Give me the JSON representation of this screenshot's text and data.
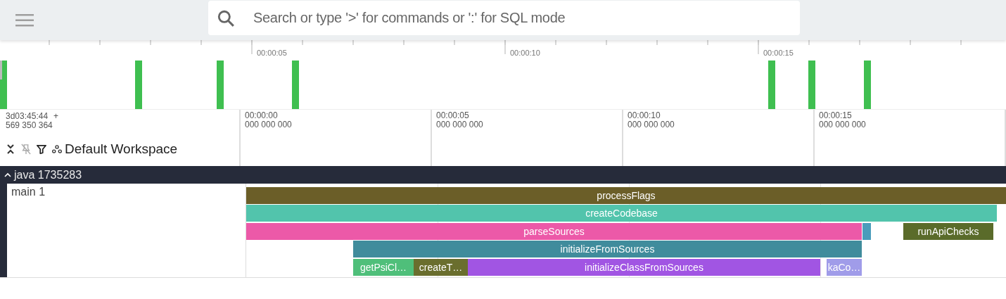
{
  "topbar": {
    "search": {
      "placeholder": "Search or type '>' for commands or ':' for SQL mode"
    }
  },
  "overview": {
    "ticks": [
      "00:00:05",
      "00:00:10",
      "00:00:15"
    ]
  },
  "time_axis": {
    "offset": {
      "time": "3d03:45:44",
      "sign": "+",
      "ns": "569 350 364"
    },
    "ticks": [
      {
        "time": "00:00:00",
        "ns": "000 000 000"
      },
      {
        "time": "00:00:05",
        "ns": "000 000 000"
      },
      {
        "time": "00:00:10",
        "ns": "000 000 000"
      },
      {
        "time": "00:00:15",
        "ns": "000 000 000"
      }
    ]
  },
  "workspace": {
    "name": "Default Workspace"
  },
  "process": {
    "title": "java 1735283",
    "expanded": true,
    "thread": {
      "name": "main 1",
      "slices": [
        {
          "name": "processFlags",
          "color": "#6b5e28",
          "children": [
            {
              "name": "createCodebase",
              "color": "#52c4ac",
              "children": [
                {
                  "name": "parseSources",
                  "color": "#ec59a8",
                  "children": [
                    {
                      "name": "initializeFromSources",
                      "color": "#408c9c",
                      "children": [
                        {
                          "name": "getPsiCl…",
                          "color": "#4fbf7a"
                        },
                        {
                          "name": "createT…",
                          "color": "#6a6e2e"
                        },
                        {
                          "name": "initializeClassFromSources",
                          "color": "#a155e3"
                        },
                        {
                          "name": "kaCo…",
                          "color": "#a09ce9"
                        }
                      ]
                    }
                  ]
                },
                {
                  "color": "#4a9cbb"
                },
                {
                  "name": "runApiChecks",
                  "color": "#5a6b2a"
                }
              ]
            }
          ]
        }
      ]
    }
  }
}
